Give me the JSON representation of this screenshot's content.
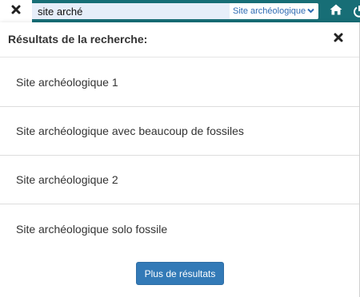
{
  "search": {
    "query": "site arché",
    "scope_selected": "Site archéologique"
  },
  "results_panel": {
    "title": "Résultats de la recherche:",
    "items": [
      {
        "label": "Site archéologique 1"
      },
      {
        "label": "Site archéologique avec beaucoup de fossiles"
      },
      {
        "label": "Site archéologique 2"
      },
      {
        "label": "Site archéologique solo fossile"
      }
    ],
    "more_button_label": "Plus de résultats"
  },
  "icons": {
    "clear": "close-icon",
    "scope_dropdown": "chevron-down-icon",
    "home": "home-icon",
    "power": "power-icon",
    "panel_close": "close-icon"
  },
  "colors": {
    "topbar": "#176e76",
    "accent_button": "#337ab7",
    "scope_text": "#2f6cb3",
    "search_highlight": "#e6eef9"
  }
}
